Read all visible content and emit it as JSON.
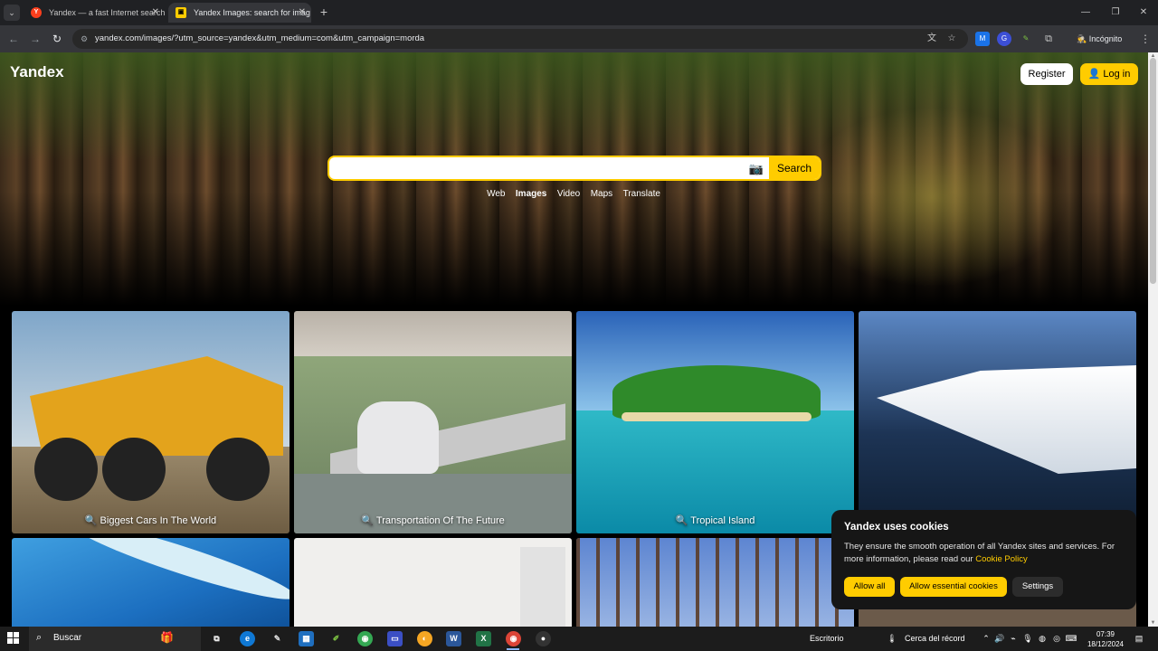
{
  "browser": {
    "tabs": [
      {
        "title": "Yandex — a fast Internet search",
        "favicon": "Y"
      },
      {
        "title": "Yandex Images: search for imag",
        "favicon": "img"
      }
    ],
    "url": "yandex.com/images/?utm_source=yandex&utm_medium=com&utm_campaign=morda",
    "incognito_label": "Incógnito"
  },
  "header": {
    "logo": "Yandex",
    "register": "Register",
    "login": "Log in"
  },
  "search": {
    "value": "",
    "button": "Search",
    "services": [
      {
        "label": "Web",
        "active": false
      },
      {
        "label": "Images",
        "active": true
      },
      {
        "label": "Video",
        "active": false
      },
      {
        "label": "Maps",
        "active": false
      },
      {
        "label": "Translate",
        "active": false
      }
    ]
  },
  "tiles": [
    {
      "caption": "Biggest Cars In The World"
    },
    {
      "caption": "Transportation Of The Future"
    },
    {
      "caption": "Tropical Island"
    },
    {
      "caption": ""
    }
  ],
  "cookie_banner": {
    "title": "Yandex uses cookies",
    "body": "They ensure the smooth operation of all Yandex sites and services. For more information, please read our ",
    "link": "Cookie Policy",
    "allow_all": "Allow all",
    "allow_essential": "Allow essential cookies",
    "settings": "Settings"
  },
  "taskbar": {
    "search_label": "Buscar",
    "desktop_label": "Escritorio",
    "weather_label": "Cerca del récord",
    "time": "07:39",
    "date": "18/12/2024"
  },
  "colors": {
    "accent": "#ffcc00",
    "chrome_dark": "#202124",
    "toolbar": "#35363a"
  }
}
